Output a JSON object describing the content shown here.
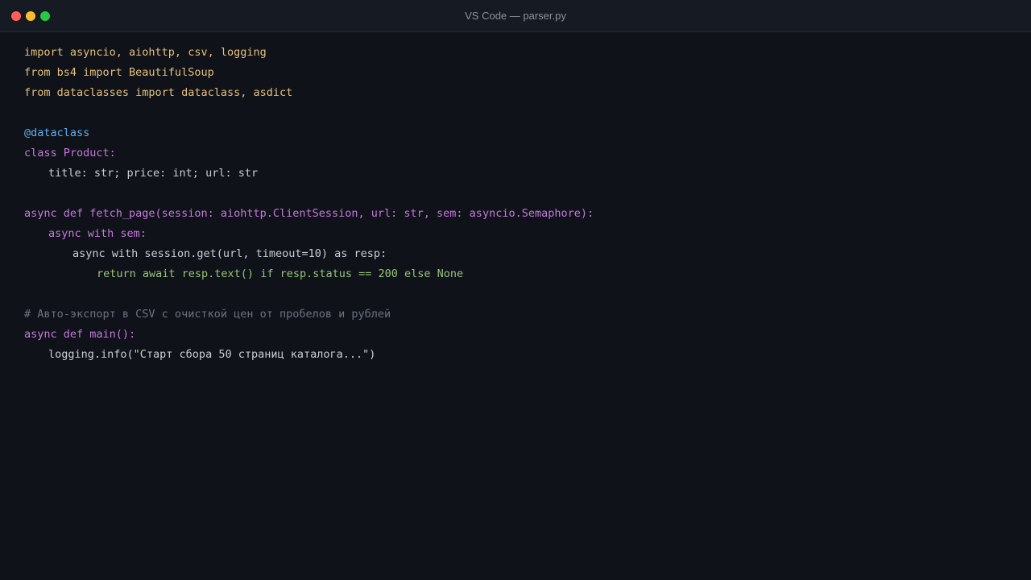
{
  "window": {
    "title": "VS Code — parser.py"
  },
  "editor": {
    "lines": [
      {
        "text": "import asyncio, aiohttp, csv, logging"
      },
      {
        "text": "from bs4 import BeautifulSoup"
      },
      {
        "text": "from dataclasses import dataclass, asdict"
      },
      {
        "text": ""
      },
      {
        "text": "@dataclass"
      },
      {
        "text": "class Product:"
      },
      {
        "text": "title: str; price: int; url: str"
      },
      {
        "text": ""
      },
      {
        "text": "async def fetch_page(session: aiohttp.ClientSession, url: str, sem: asyncio.Semaphore):"
      },
      {
        "text": "async with sem:"
      },
      {
        "text": "async with session.get(url, timeout=10) as resp:"
      },
      {
        "text": "return await resp.text() if resp.status == 200 else None"
      },
      {
        "text": ""
      },
      {
        "text": "# Авто-экспорт в CSV с очисткой цен от пробелов и рублей"
      },
      {
        "text": "async def main():"
      },
      {
        "text": "logging.info(\"Старт сбора 50 страниц каталога...\")"
      }
    ]
  },
  "colors": {
    "background": "#0f1219",
    "titlebar": "#161a22",
    "import": "#e5c07b",
    "decorator": "#61afef",
    "keyword": "#c678dd",
    "plain": "#c9ced6",
    "string_green": "#98c379",
    "comment": "#6b7280",
    "close": "#ff5f57",
    "minimize": "#febc2e",
    "maximize": "#28c840"
  }
}
